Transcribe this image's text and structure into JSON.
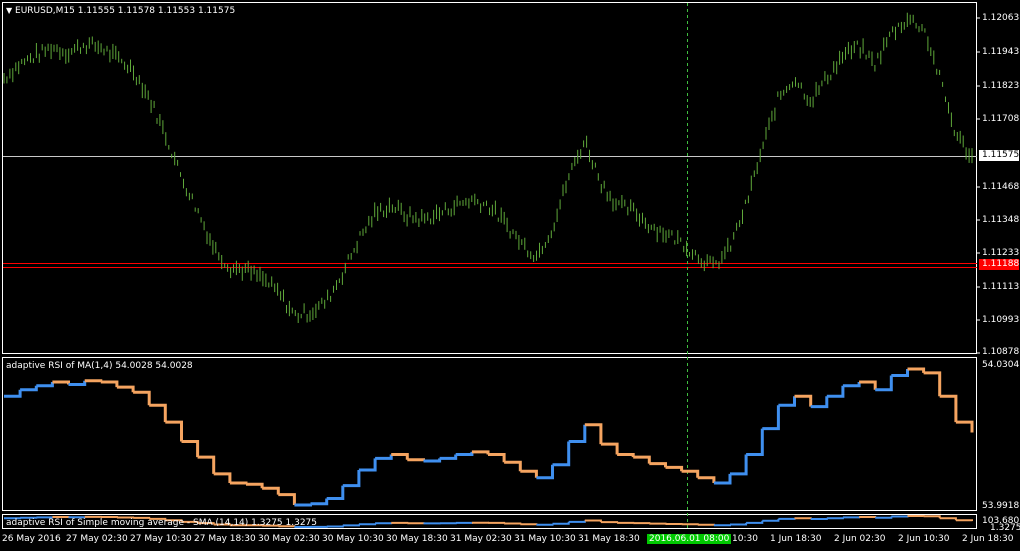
{
  "colors": {
    "background": "#000000",
    "frame": "#ffffff",
    "candles": "#5fa83a",
    "rsi_up": "#3f8fef",
    "rsi_down": "#f5a460",
    "level_line": "#ff0000",
    "crosshair": "#3fbf3f",
    "time_highlight": "#00c800"
  },
  "header": {
    "menu_icon": "triangle-down-icon",
    "title": "EURUSD,M15  1.11555 1.11578 1.11553 1.11575"
  },
  "price_panel": {
    "axis_labels": [
      "1.12063",
      "1.11943",
      "1.11823",
      "1.11708",
      "1.11575",
      "1.11468",
      "1.11348",
      "1.11233",
      "1.11188",
      "1.11113",
      "1.10993",
      "1.10878"
    ],
    "current_price": "1.11575",
    "level_price": "1.11188"
  },
  "rsi_panel": {
    "title": "adaptive RSI of MA(1,4) 54.0028 54.0028",
    "top_value": "54.0304",
    "bottom_value": "53.9918"
  },
  "sma_panel": {
    "title": "adaptive RSI of Simple moving average - SMA (14,14) 1.3275 1.3275",
    "top_value": "103.6807",
    "bottom_value": "1.3275"
  },
  "time_axis": {
    "labels": [
      "26 May 2016",
      "27 May 02:30",
      "27 May 10:30",
      "27 May 18:30",
      "30 May 02:30",
      "30 May 10:30",
      "30 May 18:30",
      "31 May 02:30",
      "31 May 10:30",
      "31 May 18:30",
      "2016.06.01 08:00",
      "10:30",
      "1 Jun 18:30",
      "2 Jun 02:30",
      "2 Jun 10:30",
      "2 Jun 18:30"
    ],
    "highlight": "2016.06.01 08:00"
  },
  "chart_data": {
    "type": "line",
    "series": [
      {
        "name": "EURUSD,M15",
        "values": [
          1.1185,
          1.119,
          1.1193,
          1.1196,
          1.1194,
          1.1197,
          1.1196,
          1.1192,
          1.1188,
          1.1178,
          1.1165,
          1.115,
          1.1138,
          1.1125,
          1.1118,
          1.1117,
          1.1114,
          1.1109,
          1.1101,
          1.1102,
          1.1106,
          1.1116,
          1.1128,
          1.1137,
          1.114,
          1.1136,
          1.1135,
          1.1137,
          1.114,
          1.1142,
          1.114,
          1.1134,
          1.1127,
          1.1122,
          1.1132,
          1.115,
          1.1163,
          1.1148,
          1.114,
          1.1138,
          1.1133,
          1.113,
          1.1127,
          1.1122,
          1.1118,
          1.1125,
          1.114,
          1.116,
          1.1178,
          1.1185,
          1.1177,
          1.1185,
          1.1193,
          1.1196,
          1.119,
          1.1201,
          1.1206,
          1.1203,
          1.1185,
          1.1165,
          1.1157
        ]
      }
    ]
  }
}
